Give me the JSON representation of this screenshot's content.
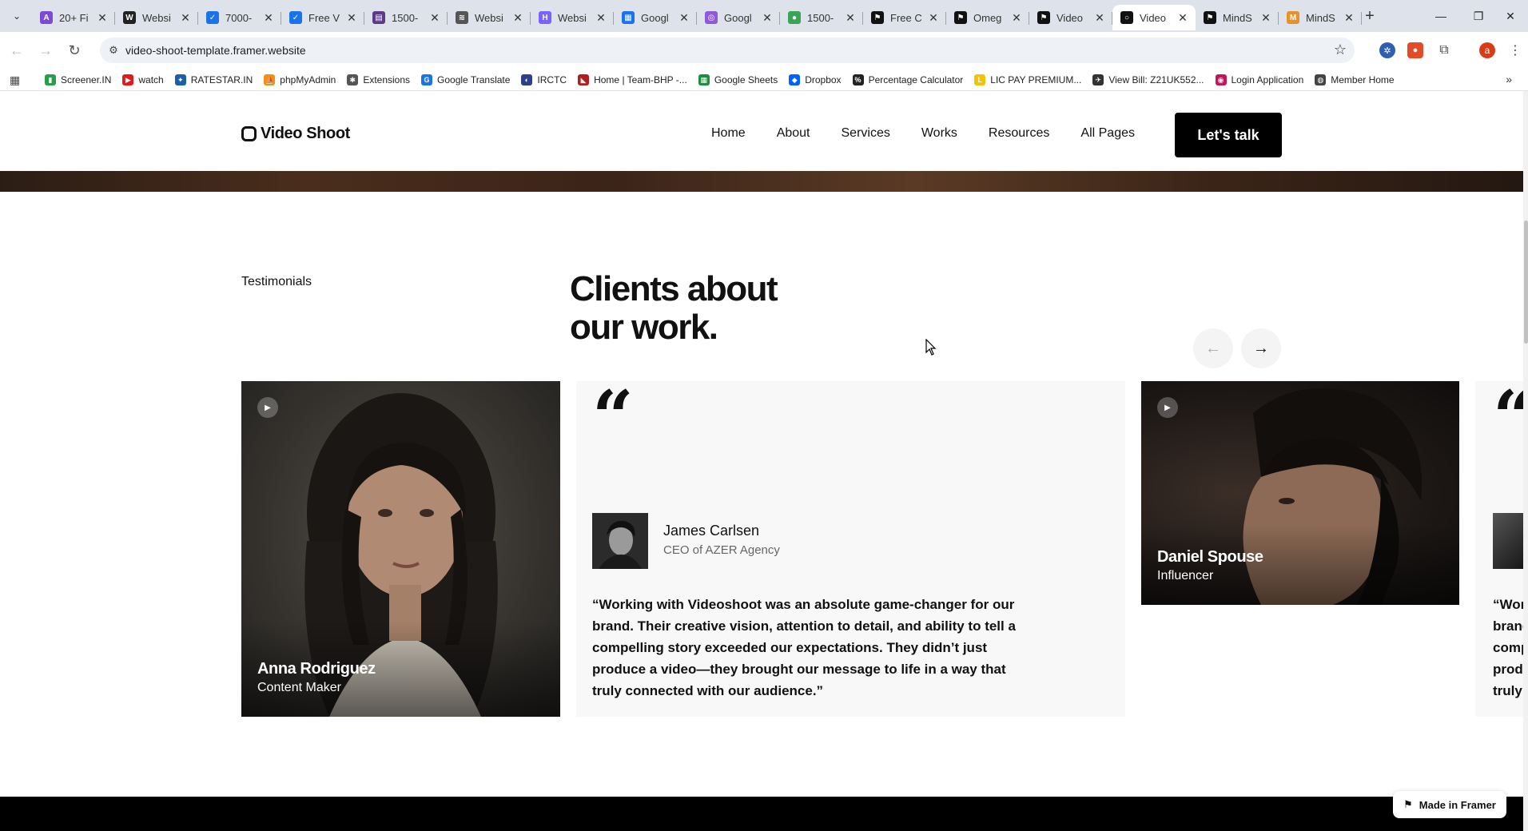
{
  "browser": {
    "tabs": [
      {
        "title": "20+ Fi",
        "color": "#7b4bd8",
        "glyph": "A"
      },
      {
        "title": "Websi",
        "color": "#222222",
        "glyph": "W"
      },
      {
        "title": "7000-",
        "color": "#1a73e8",
        "glyph": "✓"
      },
      {
        "title": "Free V",
        "color": "#1a73e8",
        "glyph": "✓"
      },
      {
        "title": "1500-",
        "color": "#5b3a8a",
        "glyph": "▤"
      },
      {
        "title": "Websi",
        "color": "#555555",
        "glyph": "≋"
      },
      {
        "title": "Websi",
        "color": "#7b61ff",
        "glyph": "H"
      },
      {
        "title": "Googl",
        "color": "#1a73e8",
        "glyph": "▦"
      },
      {
        "title": "Googl",
        "color": "#8e5ad6",
        "glyph": "◎"
      },
      {
        "title": "1500-",
        "color": "#3aa655",
        "glyph": "●"
      },
      {
        "title": "Free C",
        "color": "#111111",
        "glyph": "⚑"
      },
      {
        "title": "Omeg",
        "color": "#111111",
        "glyph": "⚑"
      },
      {
        "title": "Video",
        "color": "#111111",
        "glyph": "⚑"
      },
      {
        "title": "Video",
        "color": "#111111",
        "glyph": "○",
        "active": true
      },
      {
        "title": "MindS",
        "color": "#111111",
        "glyph": "⚑"
      },
      {
        "title": "MindS",
        "color": "#e8912a",
        "glyph": "M"
      }
    ],
    "url": "video-shoot-template.framer.website",
    "profile_initial": "a",
    "bookmarks": [
      {
        "label": "Screener.IN",
        "color": "#2a9d4b",
        "glyph": "▮"
      },
      {
        "label": "watch",
        "color": "#e01b1b",
        "glyph": "▶"
      },
      {
        "label": "RATESTAR.IN",
        "color": "#1b5fa8",
        "glyph": "✦"
      },
      {
        "label": "phpMyAdmin",
        "color": "#f29111",
        "glyph": "⛵"
      },
      {
        "label": "Extensions",
        "color": "#555555",
        "glyph": "✱"
      },
      {
        "label": "Google Translate",
        "color": "#1a73e8",
        "glyph": "G"
      },
      {
        "label": "IRCTC",
        "color": "#2c3e8c",
        "glyph": "◐"
      },
      {
        "label": "Home | Team-BHP -...",
        "color": "#b21d1d",
        "glyph": "◣"
      },
      {
        "label": "Google Sheets",
        "color": "#1e8e3e",
        "glyph": "▦"
      },
      {
        "label": "Dropbox",
        "color": "#0061fe",
        "glyph": "◆"
      },
      {
        "label": "Percentage Calculator",
        "color": "#222222",
        "glyph": "%"
      },
      {
        "label": "LIC PAY PREMIUM...",
        "color": "#f5c400",
        "glyph": "L"
      },
      {
        "label": "View Bill: Z21UK552...",
        "color": "#333333",
        "glyph": "✈"
      },
      {
        "label": "Login Application",
        "color": "#c2185b",
        "glyph": "◉"
      },
      {
        "label": "Member Home",
        "color": "#444444",
        "glyph": "◍"
      }
    ]
  },
  "site": {
    "logo": "Video Shoot",
    "nav": [
      "Home",
      "About",
      "Services",
      "Works",
      "Resources",
      "All Pages"
    ],
    "cta": "Let's talk"
  },
  "testimonials": {
    "label": "Testimonials",
    "title_line1": "Clients about",
    "title_line2": "our work.",
    "cards": [
      {
        "name": "Anna Rodriguez",
        "role": "Content Maker"
      },
      {
        "name": "James Carlsen",
        "role": "CEO of AZER Agency",
        "quote": "“Working with Videoshoot was an absolute game-changer for our brand. Their creative vision, attention to detail, and ability to tell a compelling story exceeded our expectations. They didn’t just produce a video—they brought our message to life in a way that truly connected with our audience.”"
      },
      {
        "name": "Daniel Spouse",
        "role": "Influencer"
      }
    ],
    "partial_quote_lines": [
      "“Wor",
      "brand",
      "comp",
      "produ",
      "truly"
    ]
  },
  "badge": "Made in Framer"
}
